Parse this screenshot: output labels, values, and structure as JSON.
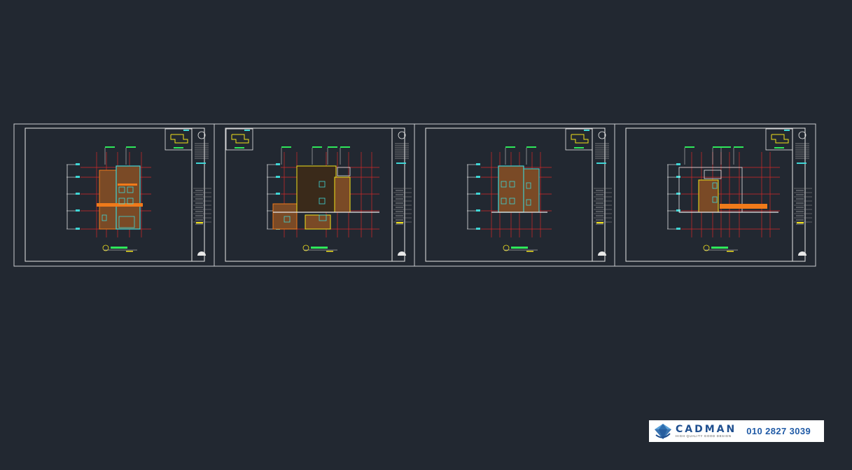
{
  "app": {
    "canvas_background": "#222831",
    "sheet_line_color": "#c9ccd0"
  },
  "colors": {
    "gridline": "#d62828",
    "outline": "#e8e8e8",
    "cyan": "#3fd6d6",
    "yellow": "#f2e21a",
    "orange": "#f07a1a",
    "brick": "#7a4a26",
    "green": "#2ee85a"
  },
  "sheets": [
    {
      "id": "elevation-1",
      "variant": "front"
    },
    {
      "id": "elevation-2",
      "variant": "long"
    },
    {
      "id": "elevation-3",
      "variant": "narrow"
    },
    {
      "id": "elevation-4",
      "variant": "rear"
    }
  ],
  "watermark": {
    "logo_icon": "diamond-logo-icon",
    "name": "CADMAN",
    "tagline": "HIGH QUALITY GOOD DESIGN",
    "phone": "010 2827 3039"
  }
}
